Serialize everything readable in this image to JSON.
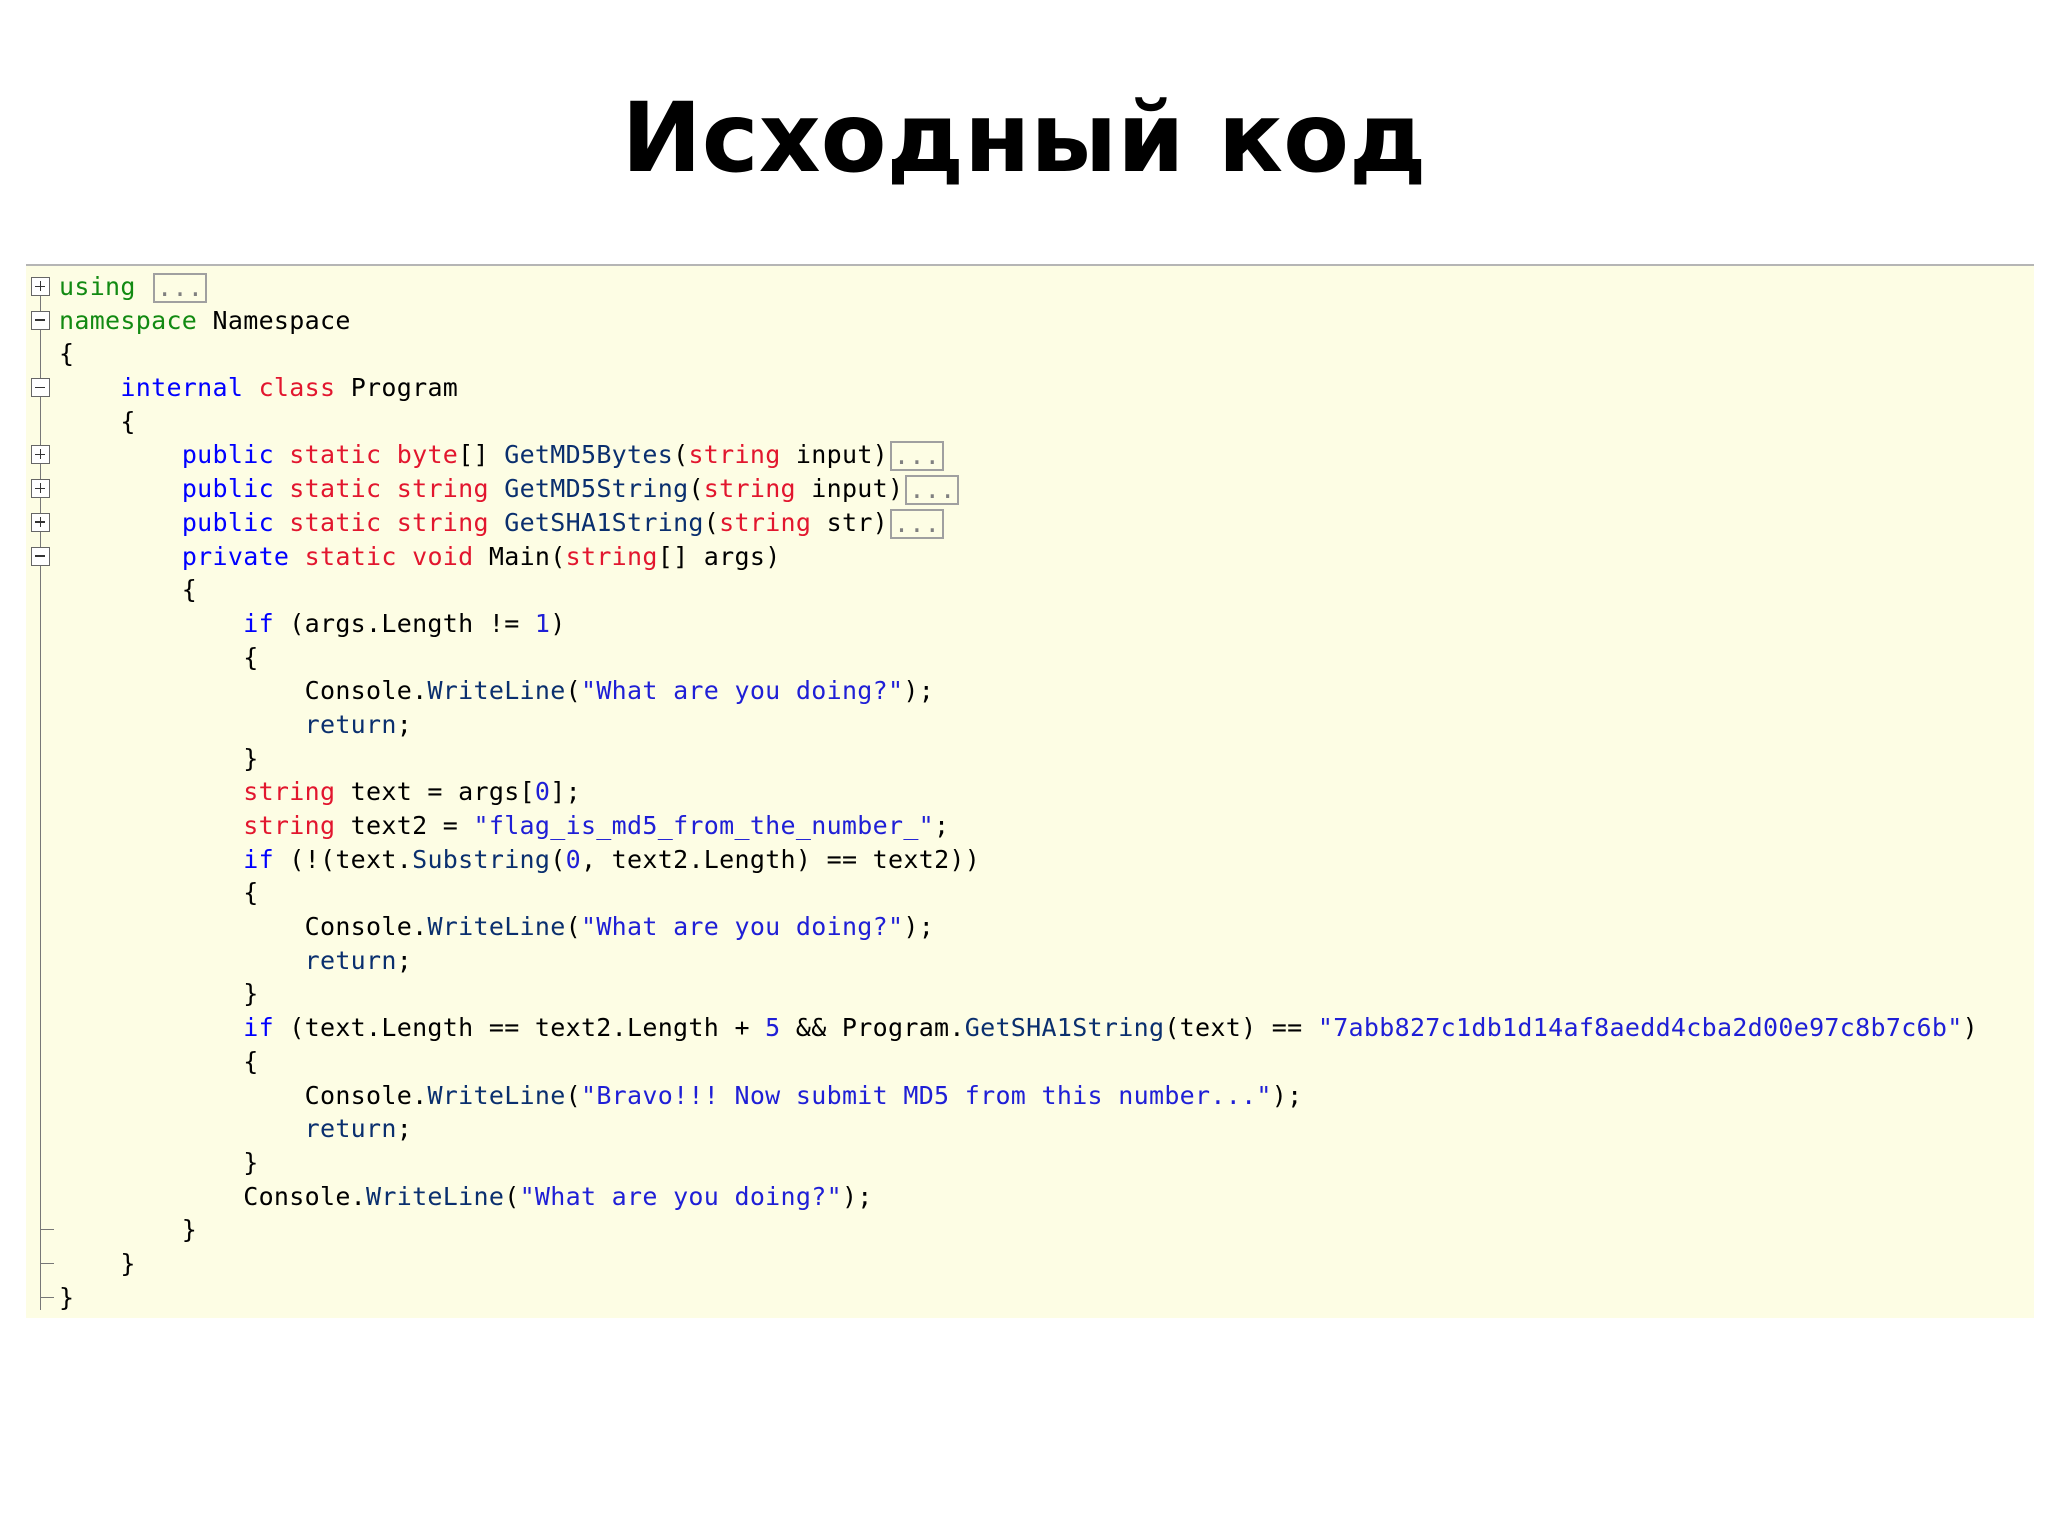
{
  "slide": {
    "title": "Исходный код"
  },
  "code_lines": [
    {
      "fold": "plus",
      "tokens": [
        {
          "t": "using",
          "c": "k-using"
        },
        {
          "t": " "
        },
        {
          "t": "...",
          "c": "collapsed"
        }
      ]
    },
    {
      "fold": "minus",
      "tokens": [
        {
          "t": "namespace",
          "c": "k-using"
        },
        {
          "t": " Namespace"
        }
      ]
    },
    {
      "fold": "",
      "tokens": [
        {
          "t": "{"
        }
      ]
    },
    {
      "fold": "minus",
      "tokens": [
        {
          "t": "    "
        },
        {
          "t": "internal",
          "c": "k-kw"
        },
        {
          "t": " "
        },
        {
          "t": "class",
          "c": "k-type"
        },
        {
          "t": " Program"
        }
      ]
    },
    {
      "fold": "",
      "tokens": [
        {
          "t": "    {"
        }
      ]
    },
    {
      "fold": "plus",
      "tokens": [
        {
          "t": "        "
        },
        {
          "t": "public",
          "c": "k-kw"
        },
        {
          "t": " "
        },
        {
          "t": "static",
          "c": "k-type"
        },
        {
          "t": " "
        },
        {
          "t": "byte",
          "c": "k-type"
        },
        {
          "t": "[] "
        },
        {
          "t": "GetMD5Bytes",
          "c": "k-method"
        },
        {
          "t": "("
        },
        {
          "t": "string",
          "c": "k-type"
        },
        {
          "t": " input)"
        },
        {
          "t": "...",
          "c": "collapsed"
        }
      ]
    },
    {
      "fold": "plus",
      "tokens": [
        {
          "t": "        "
        },
        {
          "t": "public",
          "c": "k-kw"
        },
        {
          "t": " "
        },
        {
          "t": "static",
          "c": "k-type"
        },
        {
          "t": " "
        },
        {
          "t": "string",
          "c": "k-type"
        },
        {
          "t": " "
        },
        {
          "t": "GetMD5String",
          "c": "k-method"
        },
        {
          "t": "("
        },
        {
          "t": "string",
          "c": "k-type"
        },
        {
          "t": " input)"
        },
        {
          "t": "...",
          "c": "collapsed"
        }
      ]
    },
    {
      "fold": "plus",
      "tokens": [
        {
          "t": "        "
        },
        {
          "t": "public",
          "c": "k-kw"
        },
        {
          "t": " "
        },
        {
          "t": "static",
          "c": "k-type"
        },
        {
          "t": " "
        },
        {
          "t": "string",
          "c": "k-type"
        },
        {
          "t": " "
        },
        {
          "t": "GetSHA1String",
          "c": "k-method"
        },
        {
          "t": "("
        },
        {
          "t": "string",
          "c": "k-type"
        },
        {
          "t": " str)"
        },
        {
          "t": "...",
          "c": "collapsed"
        }
      ]
    },
    {
      "fold": "minus",
      "tokens": [
        {
          "t": "        "
        },
        {
          "t": "private",
          "c": "k-kw"
        },
        {
          "t": " "
        },
        {
          "t": "static",
          "c": "k-type"
        },
        {
          "t": " "
        },
        {
          "t": "void",
          "c": "k-type"
        },
        {
          "t": " Main("
        },
        {
          "t": "string",
          "c": "k-type"
        },
        {
          "t": "[] args)"
        }
      ]
    },
    {
      "fold": "",
      "tokens": [
        {
          "t": "        {"
        }
      ]
    },
    {
      "fold": "",
      "tokens": [
        {
          "t": "            "
        },
        {
          "t": "if",
          "c": "k-kw"
        },
        {
          "t": " (args.Length != "
        },
        {
          "t": "1",
          "c": "k-num"
        },
        {
          "t": ")"
        }
      ]
    },
    {
      "fold": "",
      "tokens": [
        {
          "t": "            {"
        }
      ]
    },
    {
      "fold": "",
      "tokens": [
        {
          "t": "                Console."
        },
        {
          "t": "WriteLine",
          "c": "k-method"
        },
        {
          "t": "("
        },
        {
          "t": "\"What are you doing?\"",
          "c": "k-str"
        },
        {
          "t": ");"
        }
      ]
    },
    {
      "fold": "",
      "tokens": [
        {
          "t": "                "
        },
        {
          "t": "return",
          "c": "k-method"
        },
        {
          "t": ";"
        }
      ]
    },
    {
      "fold": "",
      "tokens": [
        {
          "t": "            }"
        }
      ]
    },
    {
      "fold": "",
      "tokens": [
        {
          "t": "            "
        },
        {
          "t": "string",
          "c": "k-type"
        },
        {
          "t": " text = args["
        },
        {
          "t": "0",
          "c": "k-num"
        },
        {
          "t": "];"
        }
      ]
    },
    {
      "fold": "",
      "tokens": [
        {
          "t": "            "
        },
        {
          "t": "string",
          "c": "k-type"
        },
        {
          "t": " text2 = "
        },
        {
          "t": "\"flag_is_md5_from_the_number_\"",
          "c": "k-str"
        },
        {
          "t": ";"
        }
      ]
    },
    {
      "fold": "",
      "tokens": [
        {
          "t": "            "
        },
        {
          "t": "if",
          "c": "k-kw"
        },
        {
          "t": " (!(text."
        },
        {
          "t": "Substring",
          "c": "k-method"
        },
        {
          "t": "("
        },
        {
          "t": "0",
          "c": "k-num"
        },
        {
          "t": ", text2.Length) == text2))"
        }
      ]
    },
    {
      "fold": "",
      "tokens": [
        {
          "t": "            {"
        }
      ]
    },
    {
      "fold": "",
      "tokens": [
        {
          "t": "                Console."
        },
        {
          "t": "WriteLine",
          "c": "k-method"
        },
        {
          "t": "("
        },
        {
          "t": "\"What are you doing?\"",
          "c": "k-str"
        },
        {
          "t": ");"
        }
      ]
    },
    {
      "fold": "",
      "tokens": [
        {
          "t": "                "
        },
        {
          "t": "return",
          "c": "k-method"
        },
        {
          "t": ";"
        }
      ]
    },
    {
      "fold": "",
      "tokens": [
        {
          "t": "            }"
        }
      ]
    },
    {
      "fold": "",
      "tokens": [
        {
          "t": "            "
        },
        {
          "t": "if",
          "c": "k-kw"
        },
        {
          "t": " (text.Length == text2.Length + "
        },
        {
          "t": "5",
          "c": "k-num"
        },
        {
          "t": " && Program."
        },
        {
          "t": "GetSHA1String",
          "c": "k-method"
        },
        {
          "t": "(text) == "
        },
        {
          "t": "\"7abb827c1db1d14af8aedd4cba2d00e97c8b7c6b\"",
          "c": "k-str"
        },
        {
          "t": ")"
        }
      ]
    },
    {
      "fold": "",
      "tokens": [
        {
          "t": "            {"
        }
      ]
    },
    {
      "fold": "",
      "tokens": [
        {
          "t": "                Console."
        },
        {
          "t": "WriteLine",
          "c": "k-method"
        },
        {
          "t": "("
        },
        {
          "t": "\"Bravo!!! Now submit MD5 from this number...\"",
          "c": "k-str"
        },
        {
          "t": ");"
        }
      ]
    },
    {
      "fold": "",
      "tokens": [
        {
          "t": "                "
        },
        {
          "t": "return",
          "c": "k-method"
        },
        {
          "t": ";"
        }
      ]
    },
    {
      "fold": "",
      "tokens": [
        {
          "t": "            }"
        }
      ]
    },
    {
      "fold": "",
      "tokens": [
        {
          "t": "            Console."
        },
        {
          "t": "WriteLine",
          "c": "k-method"
        },
        {
          "t": "("
        },
        {
          "t": "\"What are you doing?\"",
          "c": "k-str"
        },
        {
          "t": ");"
        }
      ]
    },
    {
      "fold": "end",
      "tokens": [
        {
          "t": "        }"
        }
      ]
    },
    {
      "fold": "end",
      "tokens": [
        {
          "t": "    }"
        }
      ]
    },
    {
      "fold": "end",
      "tokens": [
        {
          "t": "}"
        }
      ]
    }
  ]
}
